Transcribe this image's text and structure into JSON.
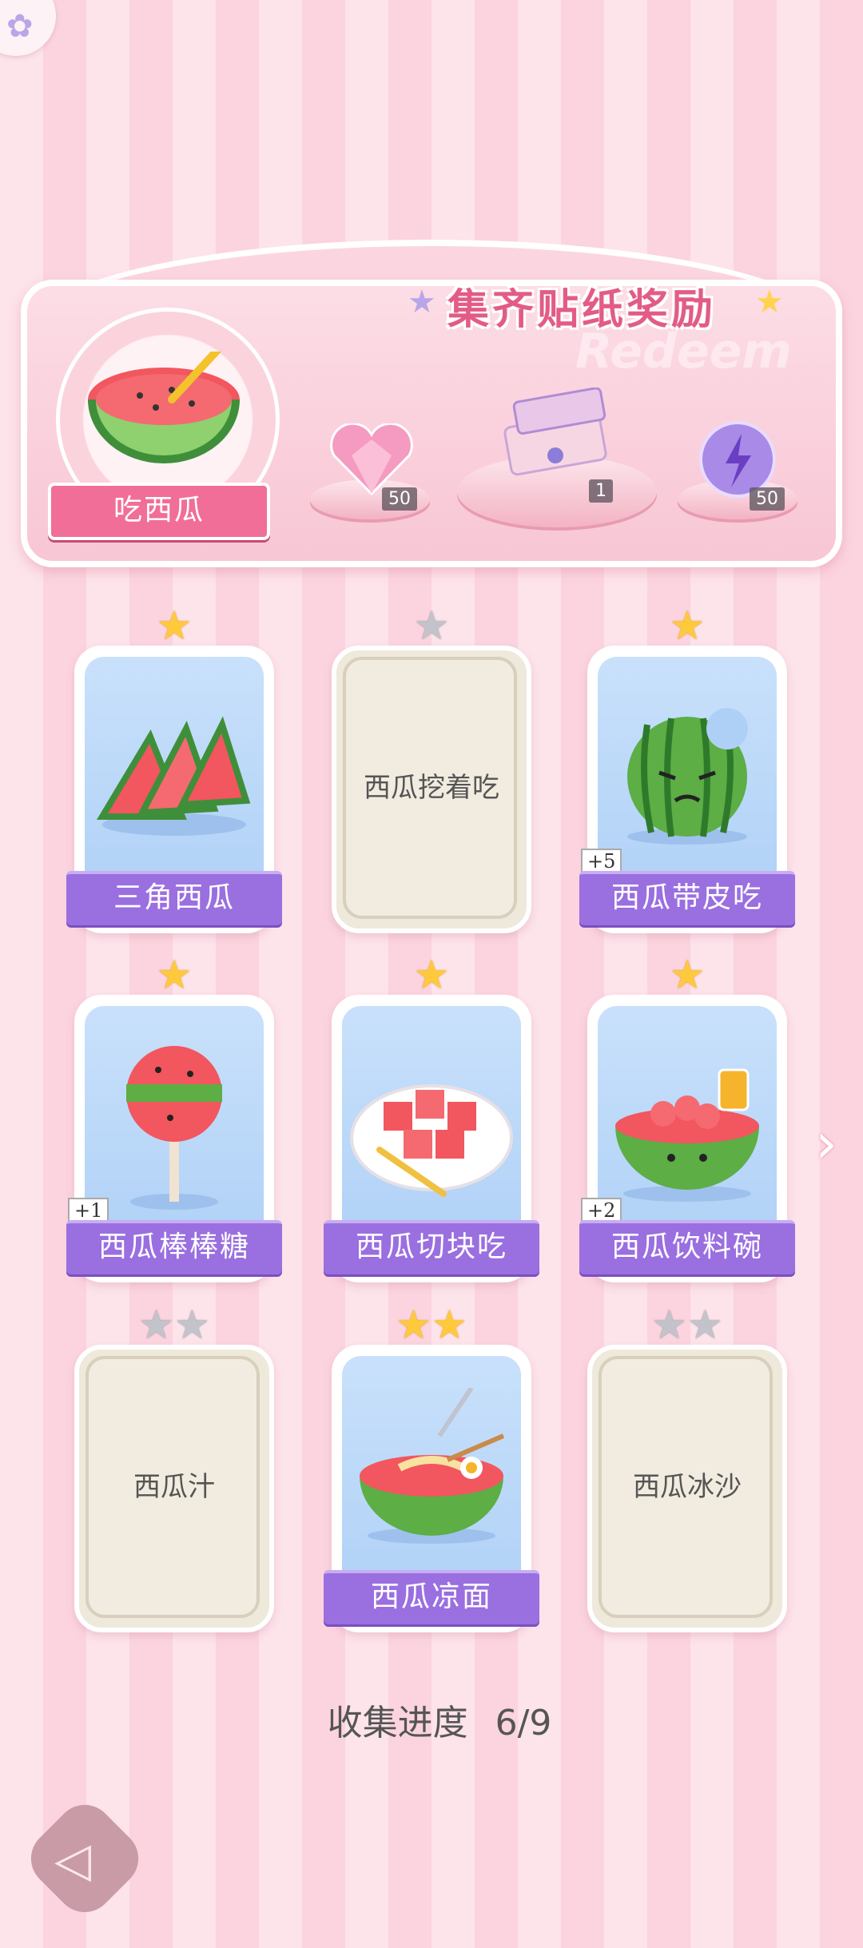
{
  "banner": {
    "title": "集齐贴纸奖励",
    "watermark": "Redeem",
    "badge_label": "吃西瓜",
    "rewards": [
      {
        "icon": "pink-heart-gem-icon",
        "count": "50"
      },
      {
        "icon": "gift-box-icon",
        "count": "1"
      },
      {
        "icon": "purple-energy-orb-icon",
        "count": "50"
      }
    ]
  },
  "cards": [
    {
      "label": "三角西瓜",
      "stars": 1,
      "unlocked": true,
      "plus": ""
    },
    {
      "label": "西瓜挖着吃",
      "stars": 1,
      "unlocked": false,
      "plus": ""
    },
    {
      "label": "西瓜带皮吃",
      "stars": 1,
      "unlocked": true,
      "plus": "+5"
    },
    {
      "label": "西瓜棒棒糖",
      "stars": 1,
      "unlocked": true,
      "plus": "+1"
    },
    {
      "label": "西瓜切块吃",
      "stars": 1,
      "unlocked": true,
      "plus": ""
    },
    {
      "label": "西瓜饮料碗",
      "stars": 1,
      "unlocked": true,
      "plus": "+2"
    },
    {
      "label": "西瓜汁",
      "stars": 2,
      "unlocked": false,
      "plus": ""
    },
    {
      "label": "西瓜凉面",
      "stars": 2,
      "unlocked": true,
      "plus": ""
    },
    {
      "label": "西瓜冰沙",
      "stars": 2,
      "unlocked": false,
      "plus": ""
    }
  ],
  "progress": {
    "label": "收集进度",
    "value": "6/9"
  }
}
